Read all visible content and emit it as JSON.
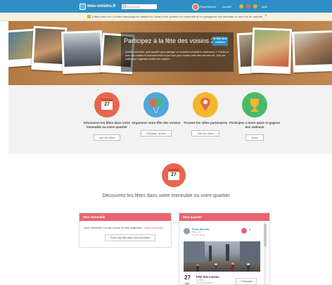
{
  "topbar": {
    "logo": "mes-voisins.fr",
    "search_placeholder": "Rechercher",
    "user_name": "Flora Beurtin",
    "nav": [
      "Accueil",
      "Aide"
    ]
  },
  "notification": {
    "text": "Faites vous en 2 à votre entourage en mettant en avant votre quartier ou immeuble et en partageant une actualité ou une info de quartier"
  },
  "hero": {
    "title": "Participez à la fête des voisins 2016",
    "badge": "la fête des voisins",
    "text": "Quelle immeuble, quel quartier pour partager un moment convivial et chaleureux ? Crédez-le avec vos voisins et retrouvez tout ce qu'il faut pour réussir cette fête via notre kit. Tous les outils pour organiser la fête des voisins !"
  },
  "features": [
    {
      "title": "Découvrez les fêtes dans votre immeuble ou votre quartier",
      "button": "Voir les fêtes"
    },
    {
      "title": "Organisez votre fête des voisins",
      "button": "Préparer la fête"
    },
    {
      "title": "Trouvez les villes partenaires",
      "button": "Voir les villes"
    },
    {
      "title": "Participez à notre quizz et gagnez des cadeaux",
      "button": "Jouer"
    }
  ],
  "calendar_day": "27",
  "section": {
    "title": "Découvrez les fêtes dans votre immeuble ou votre quartier"
  },
  "panel_building": {
    "title": "Mon immeuble",
    "text": "Votre immeuble n'a pas encore de fête organisée.",
    "link": "Soyez le premier",
    "button": "Créer une fête dans mon immeuble"
  },
  "panel_quarter": {
    "title": "Mon quartier",
    "author": "Flora Beurtin",
    "meta_1": "Paris 15",
    "meta_2": "Il y a 2 jours",
    "event_day": "27",
    "event_month": "Mai",
    "event_title": "Fête des voisins",
    "event_sub_1": "A 19h00",
    "event_sub_2": "12 rue Lecourbe",
    "event_button": "+ Participer"
  },
  "colors": {
    "brand_blue": "#2f8fc4",
    "panel_red": "#e76570",
    "icon_red": "#e8664e",
    "icon_blue": "#4ea8d8",
    "icon_yellow": "#f2b82c",
    "icon_green": "#4cb86a"
  }
}
